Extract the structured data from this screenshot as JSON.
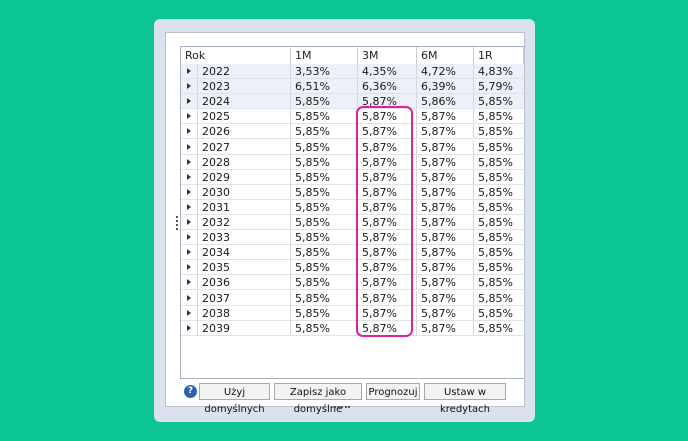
{
  "table": {
    "columns": [
      "Rok",
      "1M",
      "3M",
      "6M",
      "1R"
    ],
    "rows": [
      {
        "rok": "2022",
        "m1": "3,53%",
        "m3": "4,35%",
        "m6": "4,72%",
        "r1": "4,83%"
      },
      {
        "rok": "2023",
        "m1": "6,51%",
        "m3": "6,36%",
        "m6": "6,39%",
        "r1": "5,79%"
      },
      {
        "rok": "2024",
        "m1": "5,85%",
        "m3": "5,87%",
        "m6": "5,86%",
        "r1": "5,85%"
      },
      {
        "rok": "2025",
        "m1": "5,85%",
        "m3": "5,87%",
        "m6": "5,87%",
        "r1": "5,85%"
      },
      {
        "rok": "2026",
        "m1": "5,85%",
        "m3": "5,87%",
        "m6": "5,87%",
        "r1": "5,85%"
      },
      {
        "rok": "2027",
        "m1": "5,85%",
        "m3": "5,87%",
        "m6": "5,87%",
        "r1": "5,85%"
      },
      {
        "rok": "2028",
        "m1": "5,85%",
        "m3": "5,87%",
        "m6": "5,87%",
        "r1": "5,85%"
      },
      {
        "rok": "2029",
        "m1": "5,85%",
        "m3": "5,87%",
        "m6": "5,87%",
        "r1": "5,85%"
      },
      {
        "rok": "2030",
        "m1": "5,85%",
        "m3": "5,87%",
        "m6": "5,87%",
        "r1": "5,85%"
      },
      {
        "rok": "2031",
        "m1": "5,85%",
        "m3": "5,87%",
        "m6": "5,87%",
        "r1": "5,85%"
      },
      {
        "rok": "2032",
        "m1": "5,85%",
        "m3": "5,87%",
        "m6": "5,87%",
        "r1": "5,85%"
      },
      {
        "rok": "2033",
        "m1": "5,85%",
        "m3": "5,87%",
        "m6": "5,87%",
        "r1": "5,85%"
      },
      {
        "rok": "2034",
        "m1": "5,85%",
        "m3": "5,87%",
        "m6": "5,87%",
        "r1": "5,85%"
      },
      {
        "rok": "2035",
        "m1": "5,85%",
        "m3": "5,87%",
        "m6": "5,87%",
        "r1": "5,85%"
      },
      {
        "rok": "2036",
        "m1": "5,85%",
        "m3": "5,87%",
        "m6": "5,87%",
        "r1": "5,85%"
      },
      {
        "rok": "2037",
        "m1": "5,85%",
        "m3": "5,87%",
        "m6": "5,87%",
        "r1": "5,85%"
      },
      {
        "rok": "2038",
        "m1": "5,85%",
        "m3": "5,87%",
        "m6": "5,87%",
        "r1": "5,85%"
      },
      {
        "rok": "2039",
        "m1": "5,85%",
        "m3": "5,87%",
        "m6": "5,87%",
        "r1": "5,85%"
      }
    ],
    "tinted_rows": 3
  },
  "buttons": {
    "help_glyph": "?",
    "use_defaults": "Użyj domyślnych",
    "save_default": "Zapisz jako domyślne",
    "forecast": "Prognozuj",
    "apply_to_loans": "Ustaw w kredytach"
  },
  "colors": {
    "background": "#0bc596",
    "card": "#dbe1ee",
    "highlight": "#e0229a",
    "tinted_row": "#eef0f9",
    "help_icon": "#2d5fb5"
  }
}
